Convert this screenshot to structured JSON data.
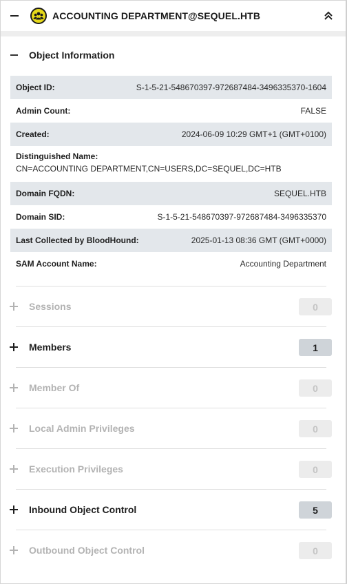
{
  "header": {
    "title": "ACCOUNTING DEPARTMENT@SEQUEL.HTB",
    "node_icon": "group-icon",
    "node_icon_color": "#e6d91a",
    "collapse_icon": "double-chevron-up-icon"
  },
  "object_info": {
    "title": "Object Information",
    "rows": [
      {
        "key": "Object ID:",
        "value": "S-1-5-21-548670397-972687484-3496335370-1604"
      },
      {
        "key": "Admin Count:",
        "value": "FALSE"
      },
      {
        "key": "Created:",
        "value": "2024-06-09 10:29 GMT+1 (GMT+0100)"
      },
      {
        "key": "Distinguished Name:",
        "value": "CN=ACCOUNTING DEPARTMENT,CN=USERS,DC=SEQUEL,DC=HTB"
      },
      {
        "key": "Domain FQDN:",
        "value": "SEQUEL.HTB"
      },
      {
        "key": "Domain SID:",
        "value": "S-1-5-21-548670397-972687484-3496335370"
      },
      {
        "key": "Last Collected by BloodHound:",
        "value": "2025-01-13 08:36 GMT (GMT+0000)"
      },
      {
        "key": "SAM Account Name:",
        "value": "Accounting Department"
      }
    ]
  },
  "sections": [
    {
      "label": "Sessions",
      "count": "0",
      "enabled": false
    },
    {
      "label": "Members",
      "count": "1",
      "enabled": true
    },
    {
      "label": "Member Of",
      "count": "0",
      "enabled": false
    },
    {
      "label": "Local Admin Privileges",
      "count": "0",
      "enabled": false
    },
    {
      "label": "Execution Privileges",
      "count": "0",
      "enabled": false
    },
    {
      "label": "Inbound Object Control",
      "count": "5",
      "enabled": true
    },
    {
      "label": "Outbound Object Control",
      "count": "0",
      "enabled": false
    }
  ]
}
